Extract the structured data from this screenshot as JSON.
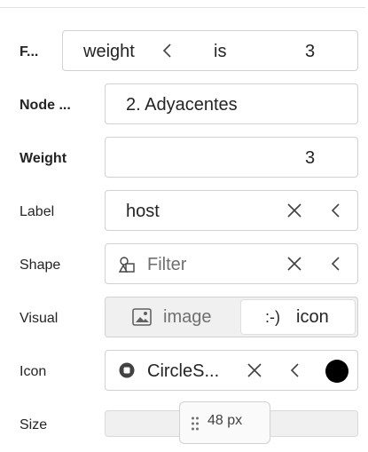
{
  "filter": {
    "label": "F...",
    "field": "weight",
    "operator": "is",
    "value": "3"
  },
  "node": {
    "label": "Node ...",
    "value": "2. Adyacentes"
  },
  "weight": {
    "label": "Weight",
    "value": "3"
  },
  "label_field": {
    "label": "Label",
    "value": "host"
  },
  "shape": {
    "label": "Shape",
    "placeholder": "Filter"
  },
  "visual": {
    "label": "Visual",
    "options": [
      "image",
      "icon"
    ],
    "selected": "icon",
    "icon_glyph": ":-)"
  },
  "icon": {
    "label": "Icon",
    "value": "CircleS...",
    "color": "#000000"
  },
  "size": {
    "label": "Size",
    "value": "48 px",
    "level_fraction": 0.5
  },
  "colors": {
    "border": "#d1d1d1",
    "divider": "#e1e1e1",
    "segment_bg": "#f0f0f0",
    "icon": "#424242"
  }
}
